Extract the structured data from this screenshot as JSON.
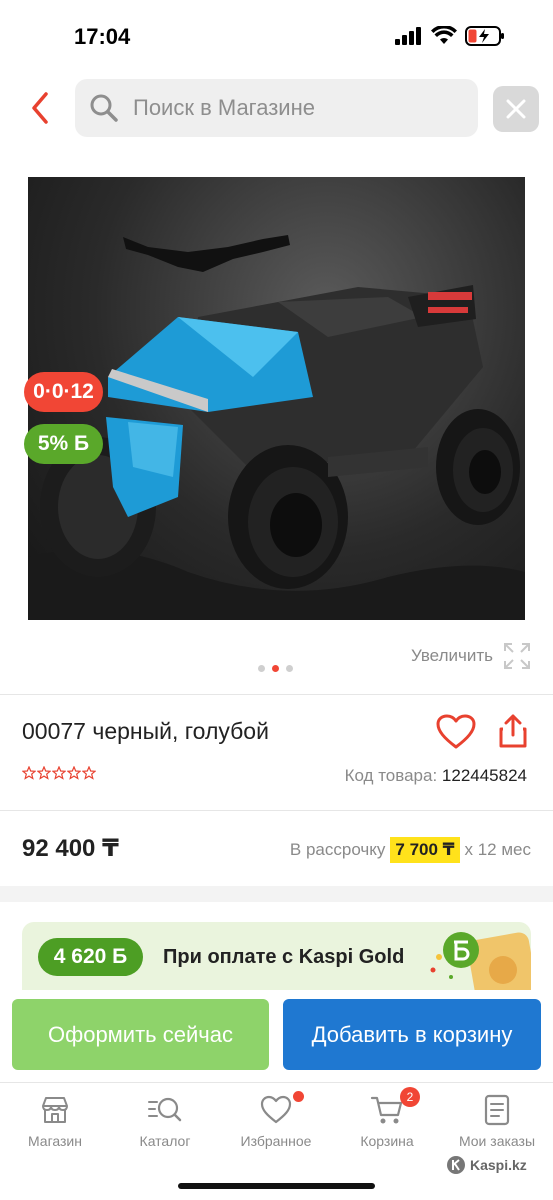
{
  "status_bar": {
    "time": "17:04"
  },
  "search": {
    "placeholder": "Поиск в Магазине"
  },
  "product": {
    "badge_installment": "0·0·12",
    "badge_bonus": "5% Б",
    "zoom_label": "Увеличить",
    "title": "00077 черный, голубой",
    "sku_label": "Код товара:",
    "sku_value": "122445824",
    "price": "92 400 ₸",
    "installment_prefix": "В рассрочку",
    "installment_amount": "7 700 ₸",
    "installment_suffix": "x 12 мес",
    "rating_stars": 0,
    "gallery_active_index": 1,
    "gallery_total": 3
  },
  "kaspi_gold": {
    "bonus": "4 620 Б",
    "text": "При оплате с Kaspi Gold"
  },
  "actions": {
    "checkout": "Оформить сейчас",
    "add_to_cart": "Добавить в корзину"
  },
  "tabbar": {
    "items": [
      {
        "label": "Магазин",
        "icon": "store-icon"
      },
      {
        "label": "Каталог",
        "icon": "catalog-search-icon"
      },
      {
        "label": "Избранное",
        "icon": "heart-icon"
      },
      {
        "label": "Корзина",
        "icon": "cart-icon",
        "badge": "2"
      },
      {
        "label": "Мои заказы",
        "icon": "orders-icon"
      }
    ]
  },
  "watermark": "Kaspi.kz",
  "colors": {
    "accent_red": "#f14635",
    "green": "#5aa82a",
    "blue": "#1f78d1",
    "light_green": "#8ed36a",
    "yellow": "#ffe21b"
  }
}
